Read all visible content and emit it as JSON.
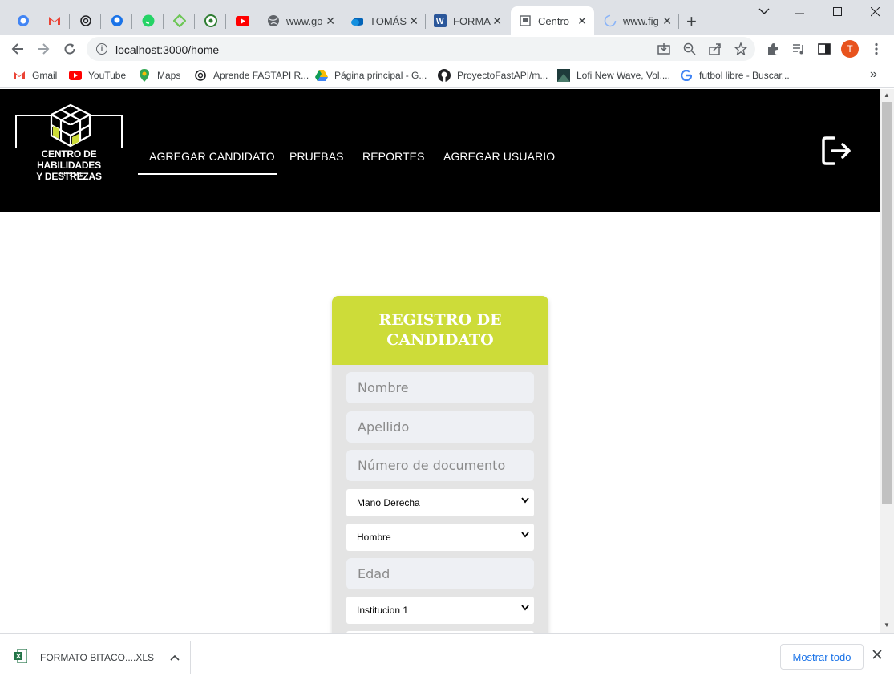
{
  "browser": {
    "tabs": [
      {
        "type": "pinned",
        "icon": "chromium-icon"
      },
      {
        "type": "pinned",
        "icon": "gmail-icon"
      },
      {
        "type": "pinned",
        "icon": "openai-icon"
      },
      {
        "type": "pinned",
        "icon": "github-icon"
      },
      {
        "type": "pinned",
        "icon": "whatsapp-icon"
      },
      {
        "type": "pinned",
        "icon": "feedly-icon"
      },
      {
        "type": "pinned",
        "icon": "soccer-icon"
      },
      {
        "type": "pinned",
        "icon": "youtube-icon"
      },
      {
        "type": "wide",
        "icon": "globe-icon",
        "title": "www.go"
      },
      {
        "type": "wide",
        "icon": "onedrive-icon",
        "title": "TOMÁS"
      },
      {
        "type": "wide",
        "icon": "word-icon",
        "title": "FORMA"
      },
      {
        "type": "wide",
        "icon": "page-icon",
        "title": "Centro",
        "active": true
      },
      {
        "type": "wide",
        "icon": "loading-icon",
        "title": "www.fig"
      }
    ],
    "url": "localhost:3000/home",
    "profile_initial": "T",
    "bookmarks": [
      {
        "label": "Gmail",
        "icon": "gmail-icon"
      },
      {
        "label": "YouTube",
        "icon": "youtube-icon"
      },
      {
        "label": "Maps",
        "icon": "maps-icon"
      },
      {
        "label": "Aprende FASTAPI R...",
        "icon": "openai-icon"
      },
      {
        "label": "Página principal - G...",
        "icon": "drive-icon"
      },
      {
        "label": "ProyectoFastAPI/m...",
        "icon": "github-icon"
      },
      {
        "label": "Lofi New Wave, Vol....",
        "icon": "album-icon"
      },
      {
        "label": "futbol libre - Buscar...",
        "icon": "google-icon"
      }
    ]
  },
  "app": {
    "logo": {
      "line1": "CENTRO DE HABILIDADES",
      "line2": "Y DESTREZAS",
      "sub": "CRYSTAL"
    },
    "nav": [
      "AGREGAR CANDIDATO",
      "PRUEBAS",
      "REPORTES",
      "AGREGAR USUARIO"
    ],
    "form": {
      "title": "REGISTRO DE CANDIDATO",
      "nombre_placeholder": "Nombre",
      "apellido_placeholder": "Apellido",
      "documento_placeholder": "Número de documento",
      "mano_value": "Mano Derecha",
      "genero_value": "Hombre",
      "edad_placeholder": "Edad",
      "institucion_value": "Institucion 1"
    }
  },
  "downloads": {
    "file": "FORMATO BITACO....XLS",
    "show_all": "Mostrar todo"
  },
  "colors": {
    "accent": "#cddc39",
    "header_bg": "#000000",
    "card_bg": "#e4e4e4"
  }
}
